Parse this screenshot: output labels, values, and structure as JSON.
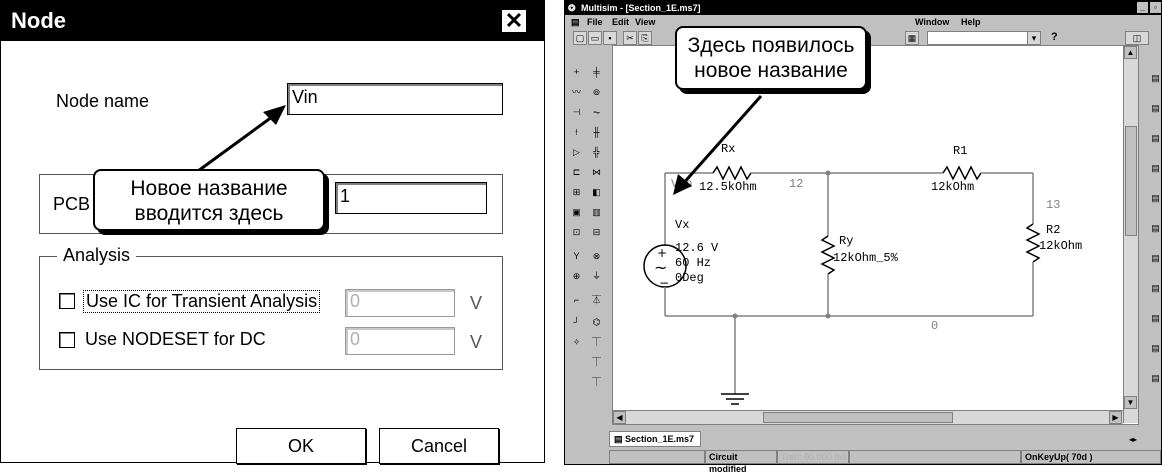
{
  "dialog": {
    "title": "Node",
    "close_glyph": "✕",
    "node_name_label": "Node name",
    "node_name_value": "Vin",
    "pcb_label": "PCB",
    "pcb_value": "1",
    "analysis_group_label": "Analysis",
    "ic_label": "Use IC for Transient Analysis",
    "ic_value": "0",
    "ic_unit": "V",
    "nodeset_label": "Use NODESET for DC",
    "nodeset_value": "0",
    "nodeset_unit": "V",
    "ok_label": "OK",
    "cancel_label": "Cancel",
    "callout_line1": "Новое название",
    "callout_line2": "вводится здесь"
  },
  "multisim": {
    "title": "Multisim - [Section_1E.ms7]",
    "menu": [
      "File",
      "Edit",
      "View",
      "Window",
      "Help"
    ],
    "help_glyph": "?",
    "callout_line1": "Здесь появилось",
    "callout_line2": "новое название",
    "circuit": {
      "rx_name": "Rx",
      "rx_value": "12.5kOhm",
      "r1_name": "R1",
      "r1_value": "12kOhm",
      "r2_name": "R2",
      "r2_value": "12kOhm",
      "ry_name": "Ry",
      "ry_value": "12kOhm_5%",
      "vx_name": "Vx",
      "vx_voltage": "12.6 V",
      "vx_freq": "60 Hz",
      "vx_phase": "0Deg",
      "node_vin": "Vin",
      "node_12": "12",
      "node_13": "13",
      "node_0": "0"
    },
    "tab_label": "Section_1E.ms7",
    "status_circuit": "Circuit modified",
    "status_tran": "Tran: 00.000 ms",
    "status_key": "OnKeyUp( 70d )",
    "icons": {
      "app": "multisim-logo-icon",
      "doc": "document-icon"
    }
  }
}
